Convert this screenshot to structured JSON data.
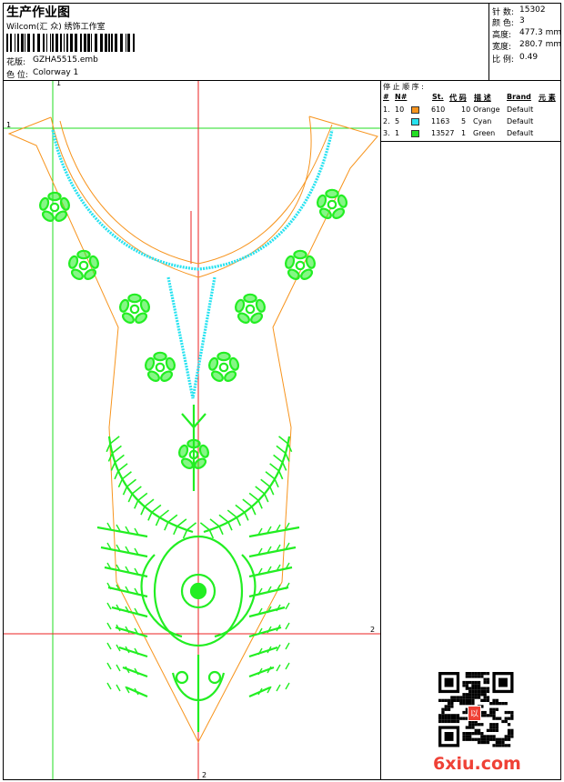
{
  "header": {
    "title": "生产作业图",
    "software": "Wilcom(汇 众) 绣饰工作室",
    "pattern_label": "花版:",
    "pattern_value": "GZHA5515.emb",
    "color_label": "色 位:",
    "color_value": "Colorway 1"
  },
  "stats": {
    "stitches_label": "针 数:",
    "stitches_value": "15302",
    "colors_label": "颜 色:",
    "colors_value": "3",
    "height_label": "高度:",
    "height_value": "477.3 mm",
    "width_label": "宽度:",
    "width_value": "280.7 mm",
    "scale_label": "比 例:",
    "scale_value": "0.49"
  },
  "stop_sequence": {
    "title": "停 止 顺 序 :",
    "columns": [
      "#",
      "N#",
      "St.",
      "代 码",
      "描 述",
      "Brand",
      "元 素"
    ],
    "rows": [
      {
        "index": "1.",
        "needle": "10",
        "color": "#f7941d",
        "stitches": "610",
        "code": "10",
        "description": "Orange",
        "brand": "Default"
      },
      {
        "index": "2.",
        "needle": "5",
        "color": "#27e2f0",
        "stitches": "1163",
        "code": "5",
        "description": "Cyan",
        "brand": "Default"
      },
      {
        "index": "3.",
        "needle": "1",
        "color": "#22dd22",
        "stitches": "13527",
        "code": "1",
        "description": "Green",
        "brand": "Default"
      }
    ]
  },
  "guides": {
    "v1": "1",
    "h1": "1",
    "h2": "2",
    "v2": "2"
  },
  "watermark": "6xiu.com",
  "seal": "以",
  "colors": {
    "outline": "#f7941d",
    "neck": "#27e2f0",
    "motif": "#22ee22",
    "guide_green": "#22dd22",
    "guide_red": "#ee2222",
    "brand_red": "#ef4136"
  }
}
